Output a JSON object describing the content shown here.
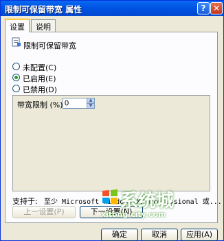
{
  "window": {
    "title": "限制可保留带宽 属性",
    "help_glyph": "?",
    "close_glyph": "✕"
  },
  "tabs": [
    {
      "label": "设置",
      "active": true
    },
    {
      "label": "说明",
      "active": false
    }
  ],
  "policy": {
    "name": "限制可保留带宽"
  },
  "options": [
    {
      "label": "未配置(C)",
      "selected": false
    },
    {
      "label": "已启用(E)",
      "selected": true
    },
    {
      "label": "已禁用(D)",
      "selected": false
    }
  ],
  "setting": {
    "label": "带宽限制 (%):",
    "value": "0"
  },
  "support": {
    "label": "支持于:",
    "text": "至少 Microsoft Windows XP Professional 或..."
  },
  "nav": {
    "prev_label": "上一设置(P)",
    "next_label": "下一设置(N)"
  },
  "buttons": {
    "ok": "确定",
    "cancel": "取消",
    "apply": "应用(A)"
  },
  "watermark": {
    "text": "系统城",
    "url": "xitong city.com"
  },
  "colors": {
    "titlebar": "#0054e3",
    "face": "#ece9d8",
    "tab_highlight": "#ffc83c"
  }
}
